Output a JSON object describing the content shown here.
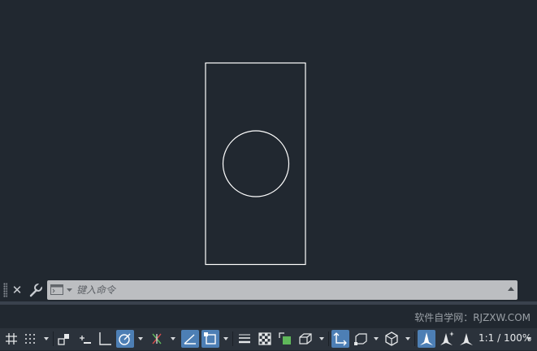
{
  "canvas": {
    "line_color": "#ffffff",
    "background_color": "#212830",
    "objects": [
      {
        "kind": "rectangle",
        "name": "rectangle-object"
      },
      {
        "kind": "circle",
        "name": "circle-object"
      }
    ]
  },
  "command_line": {
    "placeholder": "键入命令",
    "close_icon": "close-icon",
    "customize_icon": "wrench-icon",
    "recent_icon": "command-prompt-icon"
  },
  "watermark": {
    "text": "软件自学网：RJZXW.COM"
  },
  "status_bar": {
    "accent_color": "#4d7fb5",
    "buttons": [
      {
        "name": "grid-display-button",
        "icon": "grid-icon",
        "active": false
      },
      {
        "name": "snap-mode-button",
        "icon": "snap-dots-icon",
        "active": false
      },
      {
        "name": "infer-constraints-button",
        "icon": "infer-constraints-icon",
        "active": false
      },
      {
        "name": "dynamic-input-button",
        "icon": "dynamic-input-icon",
        "active": false
      },
      {
        "name": "ortho-mode-button",
        "icon": "ortho-icon",
        "active": false
      },
      {
        "name": "polar-tracking-button",
        "icon": "polar-tracking-icon",
        "active": true
      },
      {
        "name": "isometric-drafting-button",
        "icon": "isometric-icon",
        "active": false
      },
      {
        "name": "object-snap-tracking-button",
        "icon": "object-snap-tracking-icon",
        "active": true
      },
      {
        "name": "object-snap-button",
        "icon": "object-snap-icon",
        "active": true
      },
      {
        "name": "lineweight-button",
        "icon": "lineweight-icon",
        "active": false
      },
      {
        "name": "transparency-button",
        "icon": "transparency-icon",
        "active": false
      },
      {
        "name": "selection-cycling-button",
        "icon": "selection-cycling-icon",
        "active": false
      },
      {
        "name": "3d-object-snap-button",
        "icon": "3d-osnap-icon",
        "active": false
      },
      {
        "name": "dynamic-ucs-button",
        "icon": "dynamic-ucs-icon",
        "active": true
      },
      {
        "name": "selection-filter-button",
        "icon": "selection-filter-icon",
        "active": false
      },
      {
        "name": "gizmo-button",
        "icon": "gizmo-icon",
        "active": false
      },
      {
        "name": "annotation-visibility-button",
        "icon": "annotation-visibility-icon",
        "active": true
      },
      {
        "name": "auto-scale-button",
        "icon": "auto-scale-icon",
        "active": false
      },
      {
        "name": "annotation-scale-button",
        "icon": "annotation-scale-icon",
        "active": false
      }
    ],
    "scale_label": "1:1 / 100%"
  }
}
